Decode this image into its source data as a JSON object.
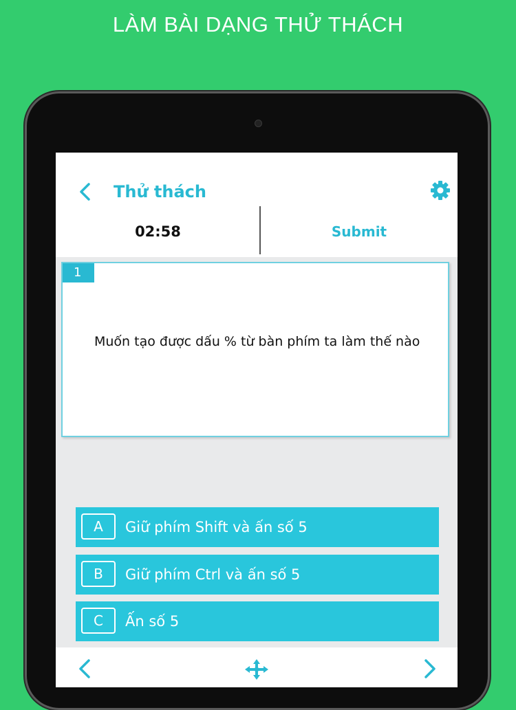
{
  "banner": {
    "title": "LÀM BÀI DẠNG THỬ THÁCH"
  },
  "header": {
    "back_icon": "chevron-left-icon",
    "title": "Thử thách",
    "settings_icon": "gear-icon"
  },
  "subbar": {
    "timer": "02:58",
    "submit_label": "Submit"
  },
  "question": {
    "number": "1",
    "text": "Muốn tạo được dấu % từ bàn phím ta làm thế nào"
  },
  "answers": [
    {
      "letter": "A",
      "text": "Giữ phím Shift và ấn số 5"
    },
    {
      "letter": "B",
      "text": "Giữ phím Ctrl và ấn số 5"
    },
    {
      "letter": "C",
      "text": "Ấn số 5"
    }
  ],
  "footer": {
    "prev_icon": "chevron-left-icon",
    "move_icon": "move-arrows-icon",
    "next_icon": "chevron-right-icon"
  },
  "colors": {
    "background": "#33cc6e",
    "accent": "#29b9d2",
    "answer_bg": "#29c6dc"
  }
}
